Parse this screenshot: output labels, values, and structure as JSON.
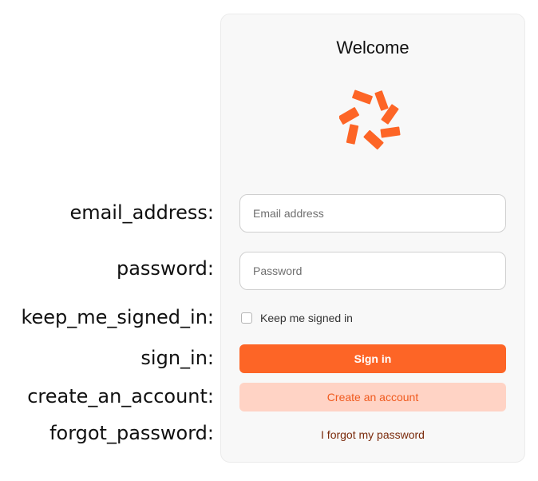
{
  "labels": {
    "email_address": "email_address:",
    "password": "password:",
    "keep_me_signed_in": "keep_me_signed_in:",
    "sign_in": "sign_in:",
    "create_an_account": "create_an_account:",
    "forgot_password": "forgot_password:"
  },
  "card": {
    "title": "Welcome",
    "logo_icon": "orange-spinner-logo-icon",
    "email": {
      "placeholder": "Email address",
      "value": ""
    },
    "password": {
      "placeholder": "Password",
      "value": ""
    },
    "keep_signed_in": {
      "label": "Keep me signed in",
      "checked": false
    },
    "sign_in_label": "Sign in",
    "create_account_label": "Create an account",
    "forgot_password_label": "I forgot my password"
  },
  "colors": {
    "accent": "#fd6526",
    "accent_light": "#ffd3c5",
    "link": "#7a2a0b",
    "card_bg": "#f8f8f8"
  }
}
